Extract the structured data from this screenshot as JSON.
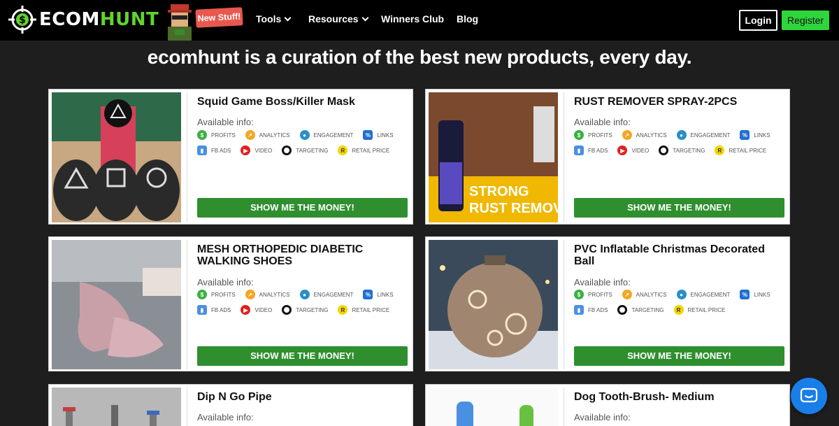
{
  "nav": {
    "logo_part1": "ECOM",
    "logo_part2": "HUNT",
    "badge": "New Stuff!",
    "links": [
      "Tools",
      "Resources",
      "Winners Club",
      "Blog"
    ],
    "login": "Login",
    "register": "Register"
  },
  "hero": {
    "headline": "ecomhunt is a curation of the best new products, every day."
  },
  "labels": {
    "available": "Available info:",
    "cta": "SHOW ME THE MONEY!"
  },
  "tags": {
    "profits": "PROFITS",
    "analytics": "ANALYTICS",
    "engagement": "ENGAGEMENT",
    "links": "LINKS",
    "fb_ads": "FB ADS",
    "video": "VIDEO",
    "targeting": "TARGETING",
    "retail_price": "RETAIL PRICE"
  },
  "products": [
    {
      "title": "Squid Game Boss/Killer Mask",
      "has_video": true
    },
    {
      "title": "RUST REMOVER SPRAY-2PCS",
      "has_video": true,
      "image_text": [
        "STRONG",
        "RUST REMOVAL"
      ]
    },
    {
      "title": "MESH ORTHOPEDIC DIABETIC WALKING SHOES",
      "has_video": true
    },
    {
      "title": "PVC Inflatable Christmas Decorated Ball",
      "has_video": false
    },
    {
      "title": "Dip N Go Pipe"
    },
    {
      "title": "Dog Tooth-Brush- Medium"
    }
  ],
  "colors": {
    "accent_green": "#2f8f2f",
    "register_green": "#2fd53c",
    "logo_green": "#5fd42e",
    "badge_red": "#e8584e",
    "chat_blue": "#1a7ee8"
  }
}
